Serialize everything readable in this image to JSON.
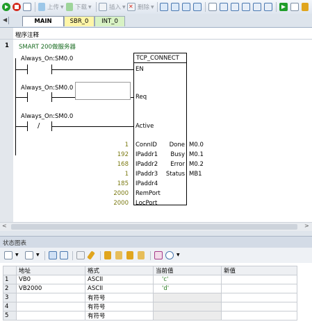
{
  "toolbar": {
    "upload_label": "上传",
    "download_label": "下载",
    "insert_label": "插入",
    "delete_label": "删除"
  },
  "tabs": [
    {
      "label": "MAIN"
    },
    {
      "label": "SBR_0"
    },
    {
      "label": "INT_0"
    }
  ],
  "editor": {
    "program_comment": "程序注释",
    "network": {
      "number": "1",
      "title": "SMART 200做服务器",
      "contact1": "Always_On:SM0.0",
      "contact2": "Always_On:SM0.0",
      "contact3": "Always_On:SM0.0",
      "contact3_symbol": "/",
      "block_title": "TCP_CONNECT",
      "pin_en": "EN",
      "pin_req": "Req",
      "pin_active": "Active",
      "inputs": [
        {
          "value": "1",
          "pin": "ConnID"
        },
        {
          "value": "192",
          "pin": "IPaddr1"
        },
        {
          "value": "168",
          "pin": "IPaddr2"
        },
        {
          "value": "1",
          "pin": "IPaddr3"
        },
        {
          "value": "185",
          "pin": "IPaddr4"
        },
        {
          "value": "2000",
          "pin": "RemPort"
        },
        {
          "value": "2000",
          "pin": "LocPort"
        }
      ],
      "outputs": [
        {
          "pin": "Done",
          "value": "M0.0"
        },
        {
          "pin": "Busy",
          "value": "M0.1"
        },
        {
          "pin": "Error",
          "value": "M0.2"
        },
        {
          "pin": "Status",
          "value": "MB1"
        }
      ]
    }
  },
  "status_chart": {
    "title": "状态图表",
    "columns": [
      "地址",
      "格式",
      "当前值",
      "新值"
    ],
    "rows": [
      {
        "num": "1",
        "address": "VB0",
        "format": "ASCII",
        "current": "'c'",
        "new": ""
      },
      {
        "num": "2",
        "address": "VB2000",
        "format": "ASCII",
        "current": "'d'",
        "new": ""
      },
      {
        "num": "3",
        "address": "",
        "format": "有符号",
        "current": "",
        "new": ""
      },
      {
        "num": "4",
        "address": "",
        "format": "有符号",
        "current": "",
        "new": ""
      },
      {
        "num": "5",
        "address": "",
        "format": "有符号",
        "current": "",
        "new": ""
      }
    ]
  },
  "colors": {
    "run_green": "#1f9d2a",
    "stop_red": "#d42b1f",
    "value_green": "#2c7d24",
    "param_olive": "#7b7a12",
    "main_tab": "#ffffff",
    "sbr_tab": "#fff6a8",
    "int_tab": "#d8f2c4"
  }
}
